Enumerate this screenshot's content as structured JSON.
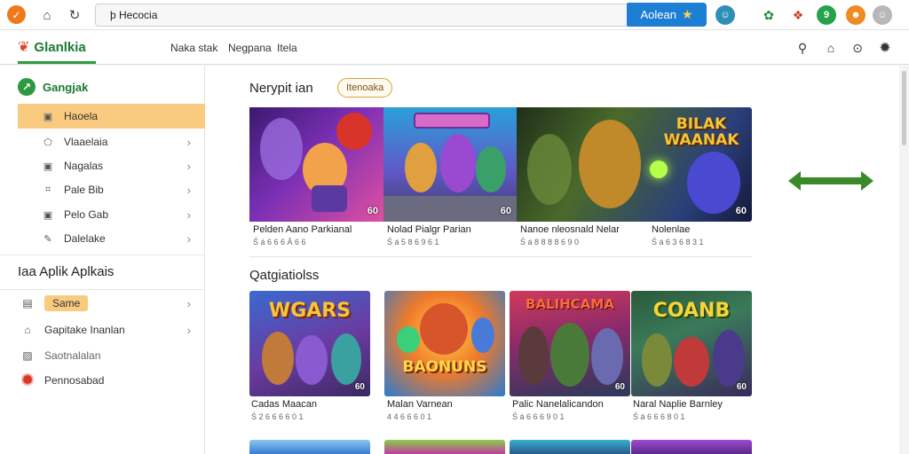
{
  "browser": {
    "url": "þ Hecocia",
    "search_button_label": "Aolean",
    "colors": {
      "accent": "#1d7fd4",
      "brand": "#ee7a1c"
    }
  },
  "site": {
    "brand": "Glanlkia",
    "nav": [
      "Naka stak",
      "Negpana",
      "Itela"
    ]
  },
  "sidebar": {
    "title": "Gangjak",
    "items": [
      {
        "label": "Haoela",
        "icon": "square-icon",
        "active": true
      },
      {
        "label": "Vlaaelaia",
        "icon": "pentagon-icon",
        "active": false
      },
      {
        "label": "Nagalas",
        "icon": "square-icon",
        "active": false
      },
      {
        "label": "Pale Bib",
        "icon": "tag-icon",
        "active": false
      },
      {
        "label": "Pelo Gab",
        "icon": "square-icon",
        "active": false
      },
      {
        "label": "Dalelake",
        "icon": "pencil-icon",
        "active": false
      }
    ],
    "section_title": "Iaa Aplik Aplkais",
    "section_items": [
      {
        "label": "Same",
        "icon": "calendar-icon",
        "pill": true
      },
      {
        "label": "Gapitake Inanlan",
        "icon": "home-icon",
        "pill": false
      },
      {
        "label": "Saotnalalan",
        "icon": "image-icon",
        "pill": false
      },
      {
        "label": "Pennosabad",
        "icon": "red-circle-icon",
        "pill": false
      }
    ]
  },
  "main": {
    "featured_title": "Nerypit ian",
    "featured_tag": "Itenoaka",
    "featured": [
      {
        "name": "Pelden Aano Parkianal",
        "meta": "Ś á 6 6 6 Â 6 6",
        "badge": "60"
      },
      {
        "name": "Nolad Pialgr Parian",
        "meta": "Ś á 5 8 6 9 6 1",
        "badge": "60"
      },
      {
        "name": "Nanoe nleosnald Nelar",
        "meta": "Ś á 8 8 8 8 6 9 0",
        "badge": ""
      },
      {
        "name": "Nolenlae",
        "meta": "Ś á 6 3 6 8 3 1",
        "badge": "60"
      }
    ],
    "banner_titles": [
      "BILAK WAANAK"
    ],
    "categories_title": "Qatgiatiolss",
    "cards": [
      {
        "name": "Cadas Maacan",
        "meta": "Ś 2 6 6 6 6 0 1",
        "art_text": "WGARS",
        "badge": "60"
      },
      {
        "name": "Malan Varnean",
        "meta": "4 4 6 6 6 0 1",
        "art_text": "BAONUNS",
        "badge": ""
      },
      {
        "name": "Palic Nanelalicandon",
        "meta": "Ś á 6 6 6 9 0 1",
        "art_text": "BALIHCAMA",
        "badge": "60"
      },
      {
        "name": "Naral Naplie Barnley",
        "meta": "Ś á 6 6 6 8 0 1",
        "art_text": "COANB",
        "badge": "60"
      }
    ]
  }
}
